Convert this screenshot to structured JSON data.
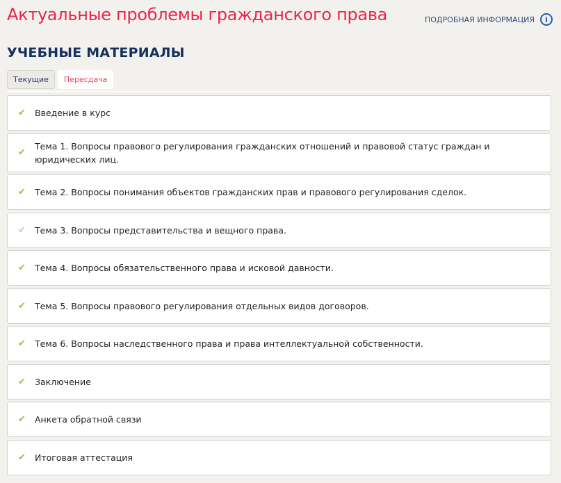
{
  "header": {
    "title": "Актуальные проблемы гражданского права",
    "info_link": "ПОДРОБНАЯ ИНФОРМАЦИЯ",
    "info_icon": "i"
  },
  "section_title": "УЧЕБНЫЕ МАТЕРИАЛЫ",
  "tabs": [
    {
      "label": "Текущие"
    },
    {
      "label": "Пересдача"
    }
  ],
  "items": [
    {
      "label": "Введение в курс",
      "status": "done"
    },
    {
      "label": "Тема 1. Вопросы правового регулирования гражданских отношений и правовой статус граждан и юридических лиц.",
      "status": "done"
    },
    {
      "label": "Тема 2. Вопросы понимания объектов гражданских прав и правового регулирования сделок.",
      "status": "done"
    },
    {
      "label": "Тема 3. Вопросы представительства и вещного права.",
      "status": "pending"
    },
    {
      "label": "Тема 4. Вопросы обязательственного права и исковой давности.",
      "status": "done"
    },
    {
      "label": "Тема 5. Вопросы правового регулирования отдельных видов договоров.",
      "status": "done"
    },
    {
      "label": "Тема 6. Вопросы наследственного права и права интеллектуальной собственности.",
      "status": "done"
    },
    {
      "label": "Заключение",
      "status": "done"
    },
    {
      "label": "Анкета обратной связи",
      "status": "done"
    },
    {
      "label": "Итоговая аттестация",
      "status": "done"
    }
  ],
  "colors": {
    "title": "#ee2449",
    "section": "#16305e",
    "check": "#8cc63f",
    "check_pending": "#c8c8c8"
  }
}
